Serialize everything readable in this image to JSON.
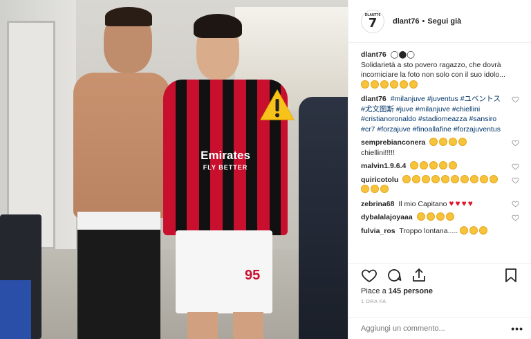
{
  "post": {
    "username": "dlant76",
    "separator": "•",
    "follow_label": "Segui già",
    "avatar_text_top": "DLANT76",
    "avatar_text_big": "7"
  },
  "photo": {
    "sponsor_main": "Emirates",
    "sponsor_sub": "FLY BETTER",
    "shirt_number": "95",
    "warning_icon": "warning-triangle-icon"
  },
  "caption": {
    "user": "dlant76",
    "symbols": "◯⬤◯",
    "text": "Solidarietà a sto povero ragazzo, che dovrà incorniciare la foto non solo con il suo idolo...",
    "emoji_count": 6
  },
  "comments": [
    {
      "user": "dlant76",
      "hashtags": [
        "#milanjuve",
        "#juventus",
        "#ユベントス",
        "#尤文图斯",
        "#juve",
        "#milanjuve",
        "#chiellini",
        "#cristianoronaldo",
        "#stadiomeazza",
        "#sansiro",
        "#cr7",
        "#forzajuve",
        "#finoallafine",
        "#forzajuventus"
      ]
    },
    {
      "user": "semprebianconera",
      "emoji_count": 4,
      "text_after": "chiellini!!!!!"
    },
    {
      "user": "malvin1.9.6.4",
      "emoji_count": 5
    },
    {
      "user": "quiricotolu",
      "emoji_count": 13
    },
    {
      "user": "zebrina68",
      "text": "Il mio Capitano",
      "hearts": 4
    },
    {
      "user": "dybalalajoyaaa",
      "emoji_count": 4
    },
    {
      "user": "fulvia_ros",
      "text": "Troppo lontana.....",
      "emoji_count": 3
    }
  ],
  "actions": {
    "likes_prefix": "Piace a",
    "likes_count": "145",
    "likes_suffix": "persone",
    "time": "1 ORA FA"
  },
  "add_comment": {
    "placeholder": "Aggiungi un commento...",
    "more_label": "•••"
  }
}
